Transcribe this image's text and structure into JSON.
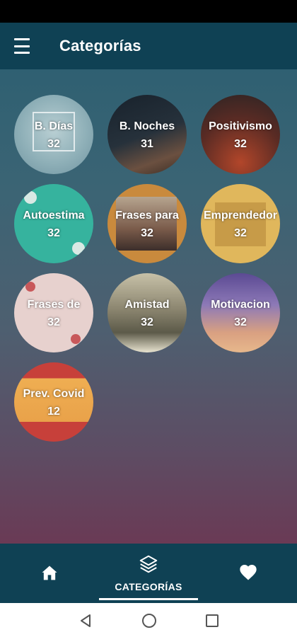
{
  "app_bar": {
    "title": "Categorías",
    "menu_icon": "hamburger-menu-icon"
  },
  "categories": [
    {
      "name": "B. Días",
      "count": "32",
      "colors": [
        "#9ab7bd",
        "#6f9aa4"
      ]
    },
    {
      "name": "B. Noches",
      "count": "31",
      "colors": [
        "#1f2a33",
        "#5a4638"
      ]
    },
    {
      "name": "Positivismo",
      "count": "32",
      "colors": [
        "#3a2a28",
        "#8a3b24"
      ]
    },
    {
      "name": "Autoestima",
      "count": "32",
      "colors": [
        "#3fb39f",
        "#2f9f8c"
      ]
    },
    {
      "name": "Frases para",
      "count": "32",
      "colors": [
        "#c58a3e",
        "#7c5a44"
      ]
    },
    {
      "name": "Emprendedor",
      "count": "32",
      "colors": [
        "#e0b85e",
        "#c9973f"
      ]
    },
    {
      "name": "Frases de",
      "count": "32",
      "colors": [
        "#e8d2cf",
        "#d9bcb8"
      ]
    },
    {
      "name": "Amistad",
      "count": "32",
      "colors": [
        "#8f8a72",
        "#5e5a48"
      ]
    },
    {
      "name": "Motivacion",
      "count": "32",
      "colors": [
        "#7d6aa8",
        "#c78f6f"
      ]
    },
    {
      "name": "Prev. Covid",
      "count": "12",
      "colors": [
        "#e9a24a",
        "#c73d36"
      ]
    }
  ],
  "bottom_nav": {
    "home_icon": "home-icon",
    "categories_label": "CATEGORÍAS",
    "categories_icon": "layers-icon",
    "favorites_icon": "heart-icon"
  },
  "system_nav": {
    "back_icon": "back-triangle-icon",
    "home_icon": "home-circle-icon",
    "recents_icon": "recents-square-icon"
  },
  "colors": {
    "bar": "#0f4154",
    "accent": "#ffffff"
  }
}
